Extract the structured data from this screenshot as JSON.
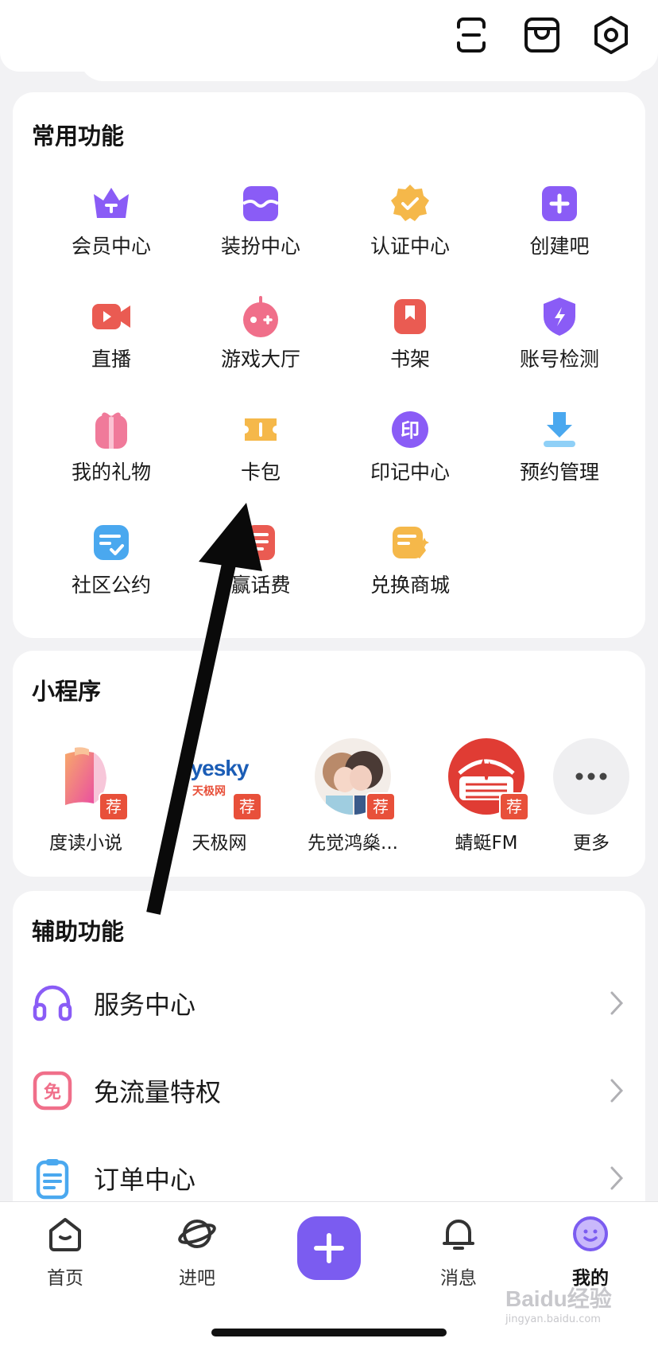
{
  "header": {
    "icons": [
      "scan-icon",
      "store-icon",
      "settings-icon"
    ]
  },
  "common": {
    "title": "常用功能",
    "items": [
      {
        "label": "会员中心",
        "icon": "crown-icon",
        "color": "#8a5cf6"
      },
      {
        "label": "装扮中心",
        "icon": "wardrobe-icon",
        "color": "#8a5cf6"
      },
      {
        "label": "认证中心",
        "icon": "verified-badge-icon",
        "color": "#f5b84a"
      },
      {
        "label": "创建吧",
        "icon": "plus-square-icon",
        "color": "#8a5cf6"
      },
      {
        "label": "直播",
        "icon": "live-camera-icon",
        "color": "#ea5b52"
      },
      {
        "label": "游戏大厅",
        "icon": "gamepad-icon",
        "color": "#f06f8a"
      },
      {
        "label": "书架",
        "icon": "bookmark-icon",
        "color": "#ea5b52"
      },
      {
        "label": "账号检测",
        "icon": "shield-bolt-icon",
        "color": "#8a5cf6"
      },
      {
        "label": "我的礼物",
        "icon": "gift-icon",
        "color": "#f07a9a"
      },
      {
        "label": "卡包",
        "icon": "ticket-icon",
        "color": "#f5b84a"
      },
      {
        "label": "印记中心",
        "icon": "seal-icon",
        "color": "#8a5cf6"
      },
      {
        "label": "预约管理",
        "icon": "download-tray-icon",
        "color": "#4aa8ef"
      },
      {
        "label": "社区公约",
        "icon": "checklist-icon",
        "color": "#4aa8ef"
      },
      {
        "label": "赢话费",
        "icon": "phone-bill-icon",
        "color": "#ea5b52"
      },
      {
        "label": "兑换商城",
        "icon": "exchange-store-icon",
        "color": "#f5b84a"
      }
    ]
  },
  "mini_programs": {
    "title": "小程序",
    "badge": "荐",
    "items": [
      {
        "label": "度读小说",
        "icon": "book-stack-logo"
      },
      {
        "label": "天极网",
        "icon": "yesky-logo",
        "logo_text_en": "yesky",
        "logo_text_cn": "天极网"
      },
      {
        "label": "先觉鸿燊...",
        "icon": "anime-couple-avatar"
      },
      {
        "label": "蜻蜓FM",
        "icon": "qingting-fm-logo"
      }
    ],
    "more_label": "更多"
  },
  "aux": {
    "title": "辅助功能",
    "items": [
      {
        "label": "服务中心",
        "icon": "headset-icon",
        "color": "#8a5cf6"
      },
      {
        "label": "免流量特权",
        "icon": "free-data-icon",
        "icon_text": "免",
        "color": "#f06f8a"
      },
      {
        "label": "订单中心",
        "icon": "clipboard-icon",
        "color": "#4aa8ef"
      }
    ]
  },
  "tabbar": {
    "tabs": [
      {
        "label": "首页",
        "icon": "home-icon",
        "active": false
      },
      {
        "label": "进吧",
        "icon": "planet-icon",
        "active": false
      },
      {
        "label": "消息",
        "icon": "bell-icon",
        "active": false
      },
      {
        "label": "我的",
        "icon": "smiley-profile-icon",
        "active": true
      }
    ],
    "accent": "#7b5cf0"
  },
  "watermark": {
    "text": "Baidu经验",
    "subtext": "jingyan.baidu.com"
  }
}
